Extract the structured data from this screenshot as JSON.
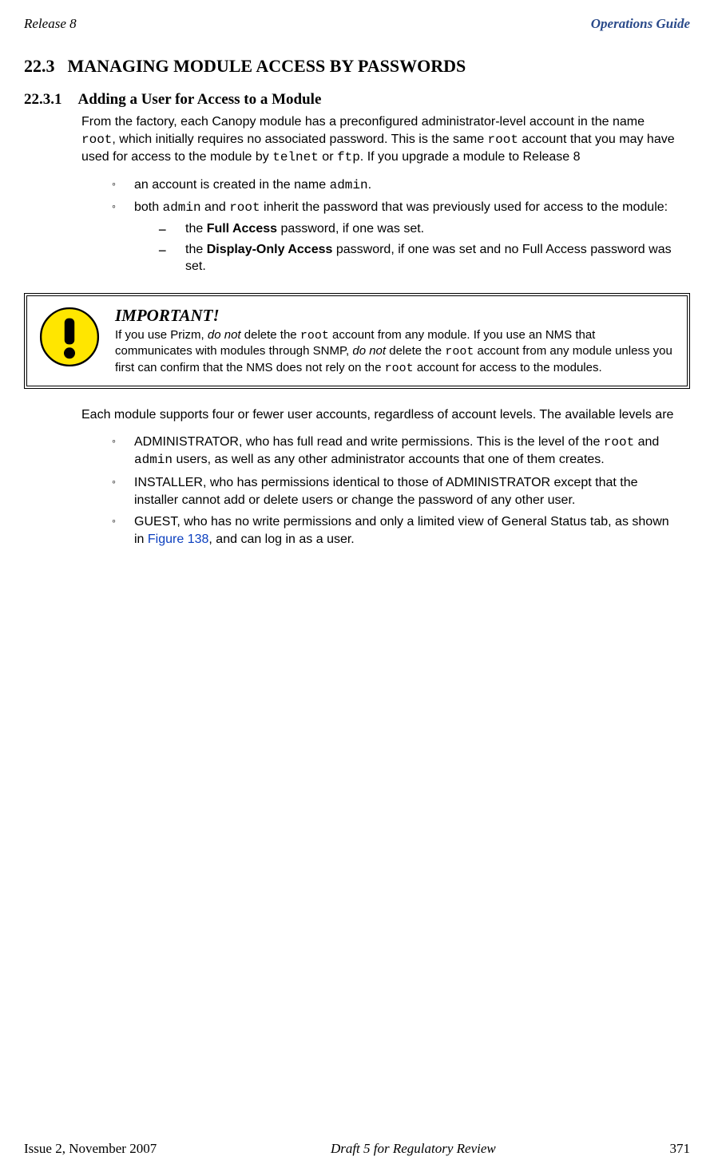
{
  "header": {
    "left": "Release 8",
    "right": "Operations Guide"
  },
  "sec_h1": {
    "num": "22.3",
    "title": "MANAGING MODULE ACCESS BY PASSWORDS"
  },
  "sec_h2": {
    "num": "22.3.1",
    "title": "Adding a User for Access to a Module"
  },
  "intro1_a": "From the factory, each Canopy module has a preconfigured administrator-level account in the name ",
  "intro1_root1": "root",
  "intro1_b": ", which initially requires no associated password. This is the same ",
  "intro1_root2": "root",
  "intro1_c": " account that you may have used for access to the module by ",
  "intro1_telnet": "telnet",
  "intro1_d": " or ",
  "intro1_ftp": "ftp",
  "intro1_e": ". If you upgrade a module to Release 8",
  "b1_a": "an account is created in the name ",
  "b1_admin": "admin",
  "b1_b": ".",
  "b2_a": "both ",
  "b2_admin": "admin",
  "b2_b": " and ",
  "b2_root": "root",
  "b2_c": " inherit the password that was previously used for access to the module:",
  "d1_a": "the ",
  "d1_bold": "Full Access",
  "d1_b": " password, if one was set.",
  "d2_a": "the ",
  "d2_bold": "Display-Only Access",
  "d2_b": " password, if one was set and no Full Access password was set.",
  "callout": {
    "title": "IMPORTANT!",
    "a": "If you use Prizm, ",
    "it1": "do not",
    "b": " delete the ",
    "root1": "root",
    "c": " account from any module. If you use an NMS that communicates with modules through SNMP, ",
    "it2": "do not",
    "d": " delete the ",
    "root2": "root",
    "e": " account from any module unless you first can confirm that the NMS does not rely on the ",
    "root3": "root",
    "f": " account for access to the modules."
  },
  "para2": "Each module supports four or fewer user accounts, regardless of account levels. The available levels are",
  "lvl1_a": "ADMINISTRATOR, who has full read and write permissions. This is the level of the ",
  "lvl1_root": "root",
  "lvl1_b": " and ",
  "lvl1_admin": "admin",
  "lvl1_c": " users, as well as any other administrator accounts that one of them creates.",
  "lvl2": "INSTALLER, who has permissions identical to those of ADMINISTRATOR except that the installer cannot add or delete users or change the password of any other user.",
  "lvl3_a": "GUEST, who has no write permissions and only a limited view of General Status tab, as shown in ",
  "lvl3_link": "Figure 138",
  "lvl3_b": ", and can log in as a user.",
  "footer": {
    "left": "Issue 2, November 2007",
    "center": "Draft 5 for Regulatory Review",
    "right": "371"
  }
}
